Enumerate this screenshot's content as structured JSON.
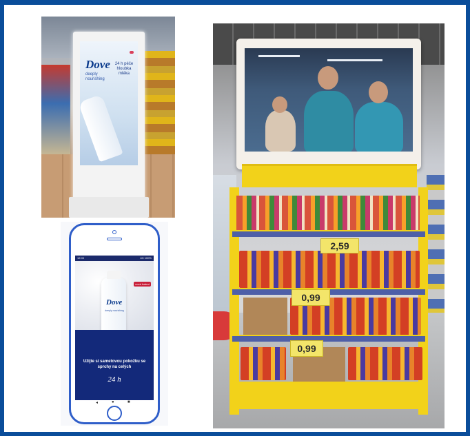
{
  "kiosk": {
    "brand": "Dove",
    "subtitle": "deeply nourishing",
    "badge": "",
    "claim": "24 h péče hloubka mléka"
  },
  "phone": {
    "status_time": "12:00",
    "status_right": "4G 100%",
    "brand": "Dove",
    "subtitle": "deeply nourishing",
    "badge": "nové balení",
    "tagline": "Užijte si sametovou pokožku se sprchy na celých",
    "hours": "24 h",
    "nav_back": "◂",
    "nav_home": "●",
    "nav_recent": "■"
  },
  "shelf": {
    "prices": [
      "2,59",
      "0,99",
      "0,99"
    ]
  },
  "colors": {
    "frame": "#0a4d9a",
    "phone_outline": "#2f5ec9",
    "display_yellow": "#f2d21a",
    "shelf_blue": "#4e5fa8"
  }
}
